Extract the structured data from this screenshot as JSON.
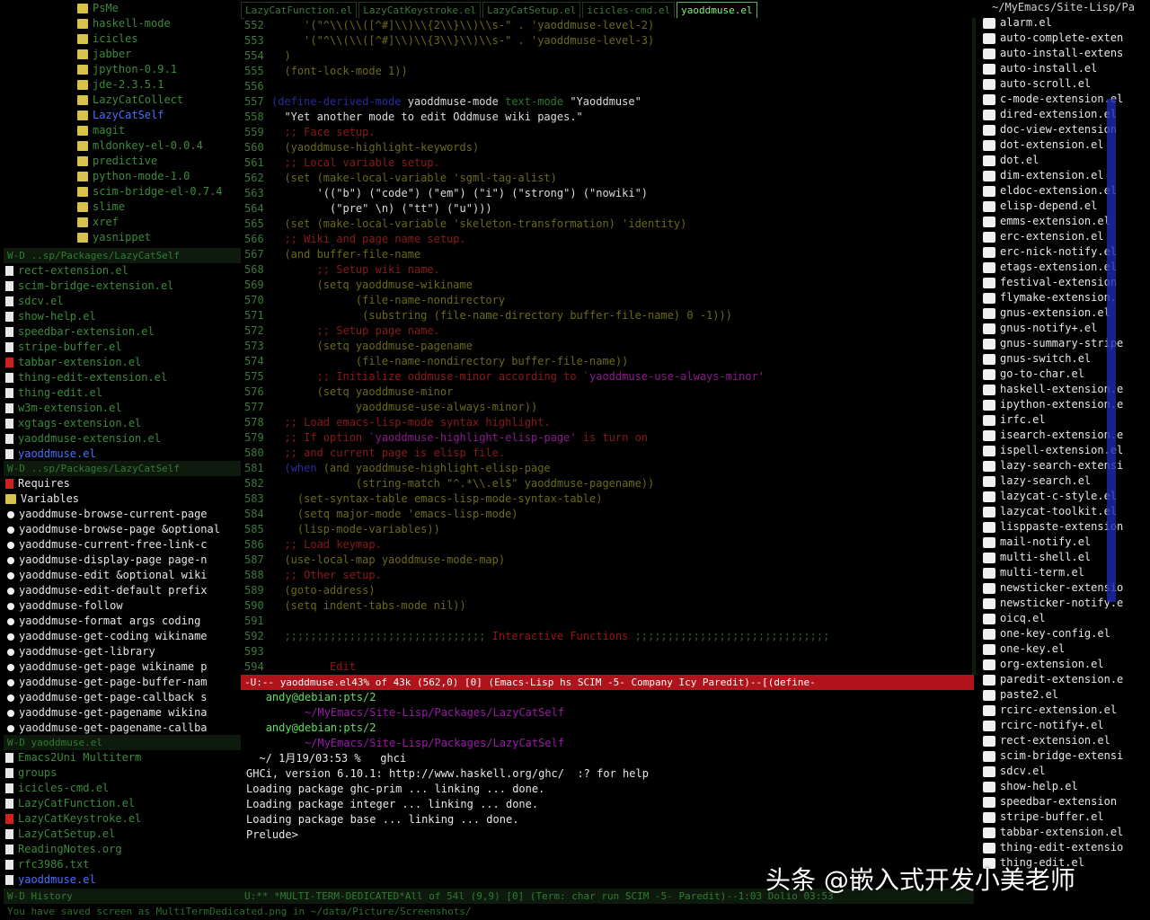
{
  "left_top_tree": {
    "items": [
      {
        "label": "PsMe",
        "kind": "folder",
        "color": "dim-g"
      },
      {
        "label": "haskell-mode",
        "kind": "folder",
        "color": "dim-g"
      },
      {
        "label": "icicles",
        "kind": "folder",
        "color": "dim-g"
      },
      {
        "label": "jabber",
        "kind": "folder",
        "color": "dim-g"
      },
      {
        "label": "jpython-0.9.1",
        "kind": "folder",
        "color": "dim-g"
      },
      {
        "label": "jde-2.3.5.1",
        "kind": "folder",
        "color": "dim-g"
      },
      {
        "label": "LazyCatCollect",
        "kind": "folder",
        "color": "dim-g"
      },
      {
        "label": "LazyCatSelf",
        "kind": "folder",
        "color": "blue"
      },
      {
        "label": "magit",
        "kind": "folder",
        "color": "dim-g"
      },
      {
        "label": "mldonkey-el-0.0.4",
        "kind": "folder",
        "color": "dim-g"
      },
      {
        "label": "predictive",
        "kind": "folder",
        "color": "dim-g"
      },
      {
        "label": "python-mode-1.0",
        "kind": "folder",
        "color": "dim-g"
      },
      {
        "label": "scim-bridge-el-0.7.4",
        "kind": "folder",
        "color": "dim-g"
      },
      {
        "label": "slime",
        "kind": "folder",
        "color": "dim-g"
      },
      {
        "label": "xref",
        "kind": "folder",
        "color": "dim-g"
      },
      {
        "label": "yasnippet",
        "kind": "folder",
        "color": "dim-g"
      }
    ],
    "modeline": "W-D  ..sp/Packages/LazyCatSelf"
  },
  "left_mid_files": {
    "items": [
      {
        "label": "rect-extension.el",
        "color": "dim-g"
      },
      {
        "label": "scim-bridge-extension.el",
        "color": "dim-g"
      },
      {
        "label": "sdcv.el",
        "color": "dim-g"
      },
      {
        "label": "show-help.el",
        "color": "dim-g"
      },
      {
        "label": "speedbar-extension.el",
        "color": "dim-g"
      },
      {
        "label": "stripe-buffer.el",
        "color": "dim-g"
      },
      {
        "label": "tabbar-extension.el",
        "color": "dim-g",
        "red": true
      },
      {
        "label": "thing-edit-extension.el",
        "color": "dim-g"
      },
      {
        "label": "thing-edit.el",
        "color": "dim-g"
      },
      {
        "label": "w3m-extension.el",
        "color": "dim-g"
      },
      {
        "label": "xgtags-extension.el",
        "color": "dim-g"
      },
      {
        "label": "yaoddmuse-extension.el",
        "color": "dim-g"
      },
      {
        "label": "yaoddmuse.el",
        "color": "blue"
      }
    ],
    "modeline": "W-D  ..sp/Packages/LazyCatSelf"
  },
  "left_outline": {
    "items": [
      {
        "label": "Requires",
        "kind": "red",
        "color": "white"
      },
      {
        "label": "Variables",
        "kind": "folder",
        "color": "white"
      },
      {
        "label": "yaoddmuse-browse-current-page",
        "color": "white"
      },
      {
        "label": "yaoddmuse-browse-page &optional",
        "color": "white"
      },
      {
        "label": "yaoddmuse-current-free-link-c",
        "color": "white"
      },
      {
        "label": "yaoddmuse-display-page page-n",
        "color": "white"
      },
      {
        "label": "yaoddmuse-edit &optional wiki",
        "color": "white"
      },
      {
        "label": "yaoddmuse-edit-default prefix",
        "color": "white"
      },
      {
        "label": "yaoddmuse-follow",
        "color": "white"
      },
      {
        "label": "yaoddmuse-format args coding",
        "color": "white"
      },
      {
        "label": "yaoddmuse-get-coding wikiname",
        "color": "white"
      },
      {
        "label": "yaoddmuse-get-library",
        "color": "white"
      },
      {
        "label": "yaoddmuse-get-page wikiname p",
        "color": "white"
      },
      {
        "label": "yaoddmuse-get-page-buffer-nam",
        "color": "white"
      },
      {
        "label": "yaoddmuse-get-page-callback s",
        "color": "white"
      },
      {
        "label": "yaoddmuse-get-pagename wikina",
        "color": "white"
      },
      {
        "label": "yaoddmuse-get-pagename-callba",
        "color": "white"
      }
    ],
    "modeline": "W-D  yaoddmuse.el"
  },
  "left_bottom_files": {
    "items": [
      {
        "label": "Emacs2Uni Multiterm",
        "color": "dim-g"
      },
      {
        "label": "groups",
        "color": "dim-g"
      },
      {
        "label": "icicles-cmd.el",
        "color": "dim-g"
      },
      {
        "label": "LazyCatFunction.el",
        "color": "dim-g"
      },
      {
        "label": "LazyCatKeystroke.el",
        "color": "dim-g",
        "red": true
      },
      {
        "label": "LazyCatSetup.el",
        "color": "dim-g"
      },
      {
        "label": "ReadingNotes.org",
        "color": "dim-g"
      },
      {
        "label": "rfc3986.txt",
        "color": "dim-g"
      },
      {
        "label": "yaoddmuse.el",
        "color": "blue"
      }
    ],
    "modeline": "W-D  History"
  },
  "tabs": [
    {
      "label": "LazyCatFunction.el",
      "active": false
    },
    {
      "label": "LazyCatKeystroke.el",
      "active": false
    },
    {
      "label": "LazyCatSetup.el",
      "active": false
    },
    {
      "label": "icicles-cmd.el",
      "active": false
    },
    {
      "label": "yaoddmuse.el",
      "active": true
    }
  ],
  "code": [
    {
      "n": "552",
      "parts": [
        [
          "c-str",
          "     '(\"^\\\\(\\\\([^#]\\\\)\\\\{2\\\\}\\\\)\\\\s-\" . 'yaoddmuse-level-2)"
        ]
      ]
    },
    {
      "n": "553",
      "parts": [
        [
          "c-str",
          "     '(\"^\\\\(\\\\([^#]\\\\)\\\\{3\\\\}\\\\)\\\\s-\" . 'yaoddmuse-level-3)"
        ]
      ]
    },
    {
      "n": "554",
      "parts": [
        [
          "c-str",
          "  )"
        ]
      ]
    },
    {
      "n": "555",
      "parts": [
        [
          "c-str",
          "  (font-lock-mode 1))"
        ]
      ]
    },
    {
      "n": "556",
      "parts": [
        [
          "c-str",
          ""
        ]
      ]
    },
    {
      "n": "557",
      "parts": [
        [
          "c-kw",
          "(define-derived-mode "
        ],
        [
          "c-white",
          "yaoddmuse-mode "
        ],
        [
          "c-fn",
          "text-mode "
        ],
        [
          "c-white",
          "\"Yaoddmuse\""
        ]
      ]
    },
    {
      "n": "558",
      "parts": [
        [
          "c-white",
          "  \"Yet another mode to edit Oddmuse wiki pages.\""
        ]
      ]
    },
    {
      "n": "559",
      "parts": [
        [
          "c-comment",
          "  ;; Face setup."
        ]
      ]
    },
    {
      "n": "560",
      "parts": [
        [
          "c-str",
          "  (yaoddmuse-highlight-keywords)"
        ]
      ]
    },
    {
      "n": "561",
      "parts": [
        [
          "c-comment",
          "  ;; Local variable setup."
        ]
      ]
    },
    {
      "n": "562",
      "parts": [
        [
          "c-str",
          "  (set (make-local-variable 'sgml-tag-alist)"
        ]
      ]
    },
    {
      "n": "563",
      "parts": [
        [
          "c-white",
          "       '((\"b\") (\"code\") (\"em\") (\"i\") (\"strong\") (\"nowiki\")"
        ]
      ]
    },
    {
      "n": "564",
      "parts": [
        [
          "c-white",
          "         (\"pre\" \\n) (\"tt\") (\"u\")))"
        ]
      ]
    },
    {
      "n": "565",
      "parts": [
        [
          "c-str",
          "  (set (make-local-variable 'skeleton-transformation) 'identity)"
        ]
      ]
    },
    {
      "n": "566",
      "parts": [
        [
          "c-comment",
          "  ;; Wiki and page name setup."
        ]
      ]
    },
    {
      "n": "567",
      "parts": [
        [
          "c-str",
          "  (and buffer-file-name"
        ]
      ]
    },
    {
      "n": "568",
      "parts": [
        [
          "c-comment",
          "       ;; Setup wiki name."
        ]
      ]
    },
    {
      "n": "569",
      "parts": [
        [
          "c-str",
          "       (setq yaoddmuse-wikiname"
        ]
      ]
    },
    {
      "n": "570",
      "parts": [
        [
          "c-str",
          "             (file-name-nondirectory"
        ]
      ]
    },
    {
      "n": "571",
      "parts": [
        [
          "c-str",
          "              (substring (file-name-directory buffer-file-name) 0 -1)))"
        ]
      ]
    },
    {
      "n": "572",
      "parts": [
        [
          "c-comment",
          "       ;; Setup page name."
        ]
      ]
    },
    {
      "n": "573",
      "parts": [
        [
          "c-str",
          "       (setq yaoddmuse-pagename"
        ]
      ]
    },
    {
      "n": "574",
      "parts": [
        [
          "c-str",
          "             (file-name-nondirectory buffer-file-name))"
        ]
      ]
    },
    {
      "n": "575",
      "parts": [
        [
          "c-comment",
          "       ;; Initialize oddmuse-minor according to "
        ],
        [
          "c-purple",
          "`yaoddmuse-use-always-minor'"
        ]
      ]
    },
    {
      "n": "576",
      "parts": [
        [
          "c-str",
          "       (setq yaoddmuse-minor"
        ]
      ]
    },
    {
      "n": "577",
      "parts": [
        [
          "c-str",
          "             yaoddmuse-use-always-minor))"
        ]
      ]
    },
    {
      "n": "578",
      "parts": [
        [
          "c-comment",
          "  ;; Load emacs-lisp-mode syntax highlight."
        ]
      ]
    },
    {
      "n": "579",
      "parts": [
        [
          "c-comment",
          "  ;; If option "
        ],
        [
          "c-purple",
          "`yaoddmuse-highlight-elisp-page'"
        ],
        [
          "c-comment",
          " is turn on"
        ]
      ]
    },
    {
      "n": "580",
      "parts": [
        [
          "c-comment",
          "  ;; and current page is elisp file."
        ]
      ]
    },
    {
      "n": "581",
      "parts": [
        [
          "c-kw",
          "  (when "
        ],
        [
          "c-str",
          "(and yaoddmuse-highlight-elisp-page"
        ]
      ]
    },
    {
      "n": "582",
      "parts": [
        [
          "c-str",
          "             (string-match \"^.*\\\\.el$\" yaoddmuse-pagename))"
        ]
      ]
    },
    {
      "n": "583",
      "parts": [
        [
          "c-str",
          "    (set-syntax-table emacs-lisp-mode-syntax-table)"
        ]
      ]
    },
    {
      "n": "584",
      "parts": [
        [
          "c-str",
          "    (setq major-mode 'emacs-lisp-mode)"
        ]
      ]
    },
    {
      "n": "585",
      "parts": [
        [
          "c-str",
          "    (lisp-mode-variables))"
        ]
      ]
    },
    {
      "n": "586",
      "parts": [
        [
          "c-comment",
          "  ;; Load keymap."
        ]
      ]
    },
    {
      "n": "587",
      "parts": [
        [
          "c-str",
          "  (use-local-map yaoddmuse-mode-map)"
        ]
      ]
    },
    {
      "n": "588",
      "parts": [
        [
          "c-comment",
          "  ;; Other setup."
        ]
      ]
    },
    {
      "n": "589",
      "parts": [
        [
          "c-str",
          "  (goto-address)"
        ]
      ]
    },
    {
      "n": "590",
      "parts": [
        [
          "c-str",
          "  (setq indent-tabs-mode nil))"
        ]
      ]
    },
    {
      "n": "591",
      "parts": [
        [
          "c-str",
          ""
        ]
      ]
    },
    {
      "n": "592",
      "parts": [
        [
          "c-sep",
          "  ;;;;;;;;;;;;;;;;;;;;;;;;;;;;;;; "
        ],
        [
          "c-red",
          "Interactive Functions"
        ],
        [
          "c-sep",
          " ;;;;;;;;;;;;;;;;;;;;;;;;;;;;;;"
        ]
      ]
    },
    {
      "n": "593",
      "parts": [
        [
          "c-str",
          ""
        ]
      ]
    },
    {
      "n": "594",
      "parts": [
        [
          "c-red",
          "         Edit"
        ]
      ]
    }
  ],
  "editor_modeline": "-U:--  yaoddmuse.el43% of 43k  (562,0)   [0]   (Emacs-Lisp hs SCIM -5- Company Icy Paredit)--[(define-",
  "terminal": [
    {
      "parts": [
        [
          "t-white",
          "   "
        ],
        [
          "t-green",
          "andy@debian:pts/2"
        ]
      ]
    },
    {
      "parts": [
        [
          "t-bar",
          "   "
        ],
        [
          "t-purple",
          "      ~/MyEmacs/Site-Lisp/Packages/LazyCatSelf"
        ]
      ]
    },
    {
      "parts": [
        [
          "t-white",
          "   "
        ],
        [
          "t-green",
          "andy@debian:pts/2"
        ]
      ]
    },
    {
      "parts": [
        [
          "t-bar",
          "   "
        ],
        [
          "t-purple",
          "      ~/MyEmacs/Site-Lisp/Packages/LazyCatSelf"
        ]
      ]
    },
    {
      "parts": [
        [
          "t-white",
          "  ~/ 1月19/03:53 %  "
        ],
        [
          "t-white",
          " ghci"
        ]
      ]
    },
    {
      "parts": [
        [
          "t-white",
          "GHCi, version 6.10.1: http://www.haskell.org/ghc/  :? for help"
        ]
      ]
    },
    {
      "parts": [
        [
          "t-white",
          "Loading package ghc-prim ... linking ... done."
        ]
      ]
    },
    {
      "parts": [
        [
          "t-white",
          "Loading package integer ... linking ... done."
        ]
      ]
    },
    {
      "parts": [
        [
          "t-white",
          "Loading package base ... linking ... done."
        ]
      ]
    },
    {
      "parts": [
        [
          "t-white",
          "Prelude> "
        ]
      ]
    }
  ],
  "terminal_modeline": "U:**  *MULTI-TERM-DEDICATED*All of 54l  (9,9)      [0]   (Term: char run SCIM -5- Paredit)--1:03 Dolio 03:53",
  "echo_area": "You have saved screen as MultiTermDedicated.png in ~/data/Picture/Screenshots/",
  "right_files": {
    "header": "~/MyEmacs/Site-Lisp/Pa",
    "items": [
      "alarm.el",
      "auto-complete-exten",
      "auto-install-extens",
      "auto-install.el",
      "auto-scroll.el",
      "c-mode-extension.el",
      "dired-extension.el",
      "doc-view-extension",
      "dot-extension.el",
      "dot.el",
      "dim-extension.el",
      "eldoc-extension.el",
      "elisp-depend.el",
      "emms-extension.el",
      "erc-extension.el",
      "erc-nick-notify.el",
      "etags-extension.el",
      "festival-extension",
      "flymake-extension.",
      "gnus-extension.el",
      "gnus-notify+.el",
      "gnus-summary-stripe",
      "gnus-switch.el",
      "go-to-char.el",
      "haskell-extension.e",
      "ipython-extension.e",
      "irfc.el",
      "isearch-extension.e",
      "ispell-extension.el",
      "lazy-search-extensi",
      "lazy-search.el",
      "lazycat-c-style.el",
      "lazycat-toolkit.el",
      "lisppaste-extension",
      "mail-notify.el",
      "multi-shell.el",
      "multi-term.el",
      "newsticker-extensio",
      "newsticker-notify.e",
      "oicq.el",
      "one-key-config.el",
      "one-key.el",
      "org-extension.el",
      "paredit-extension.e",
      "paste2.el",
      "rcirc-extension.el",
      "rcirc-notify+.el",
      "rect-extension.el",
      "scim-bridge-extensi",
      "sdcv.el",
      "show-help.el",
      "speedbar-extension",
      "stripe-buffer.el",
      "tabbar-extension.el",
      "thing-edit-extensio",
      "thing-edit.el"
    ]
  },
  "watermark": "头条 @嵌入式开发小美老师",
  "colors": {
    "modeline_active": "#b0141a",
    "tab_active": "#7df27d",
    "dir_blue": "#4a70ff"
  }
}
